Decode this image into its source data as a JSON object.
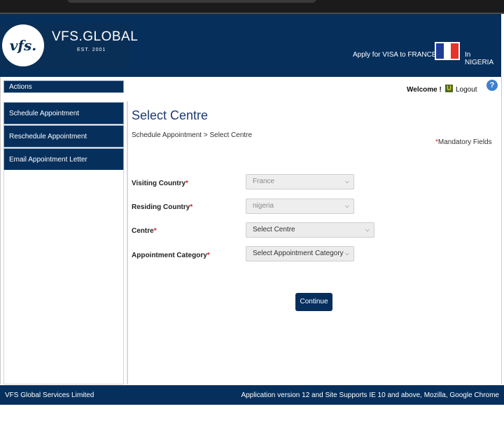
{
  "header": {
    "logo_mark": "vfs.",
    "logo_name": "VFS.GLOBAL",
    "logo_est": "EST. 2001",
    "apply_text": "Apply for VISA to FRANCE",
    "in_country": "In NIGERIA",
    "flag_colors": [
      "#1f3c95",
      "#ffffff",
      "#e8322b"
    ]
  },
  "sidebar": {
    "actions_label": "Actions",
    "items": [
      {
        "label": "Schedule Appointment"
      },
      {
        "label": "Reschedule Appointment"
      },
      {
        "label": "Email Appointment Letter"
      }
    ]
  },
  "userbar": {
    "welcome": "Welcome !",
    "logout": "Logout",
    "help": "?"
  },
  "main": {
    "title": "Select Centre",
    "breadcrumb": "Schedule Appointment  >  Select Centre",
    "mandatory_star": "*",
    "mandatory_text": "Mandatory Fields",
    "fields": [
      {
        "label": "Visiting Country",
        "required": "*",
        "value": "France"
      },
      {
        "label": "Residing Country",
        "required": "*",
        "value": "nigeria"
      },
      {
        "label": "Centre",
        "required": "*",
        "value": "Select Centre"
      },
      {
        "label": "Appointment Category",
        "required": "*",
        "value": "Select Appointment Category"
      }
    ],
    "continue_label": "Continue"
  },
  "footer": {
    "left": "VFS Global Services Limited",
    "right": "Application version 12 and Site Supports IE 10 and above, Mozilla, Google Chrome"
  },
  "colors": {
    "brand_navy": "#062f5c",
    "title_blue": "#1c3b6e",
    "required_red": "#d01f1f"
  }
}
